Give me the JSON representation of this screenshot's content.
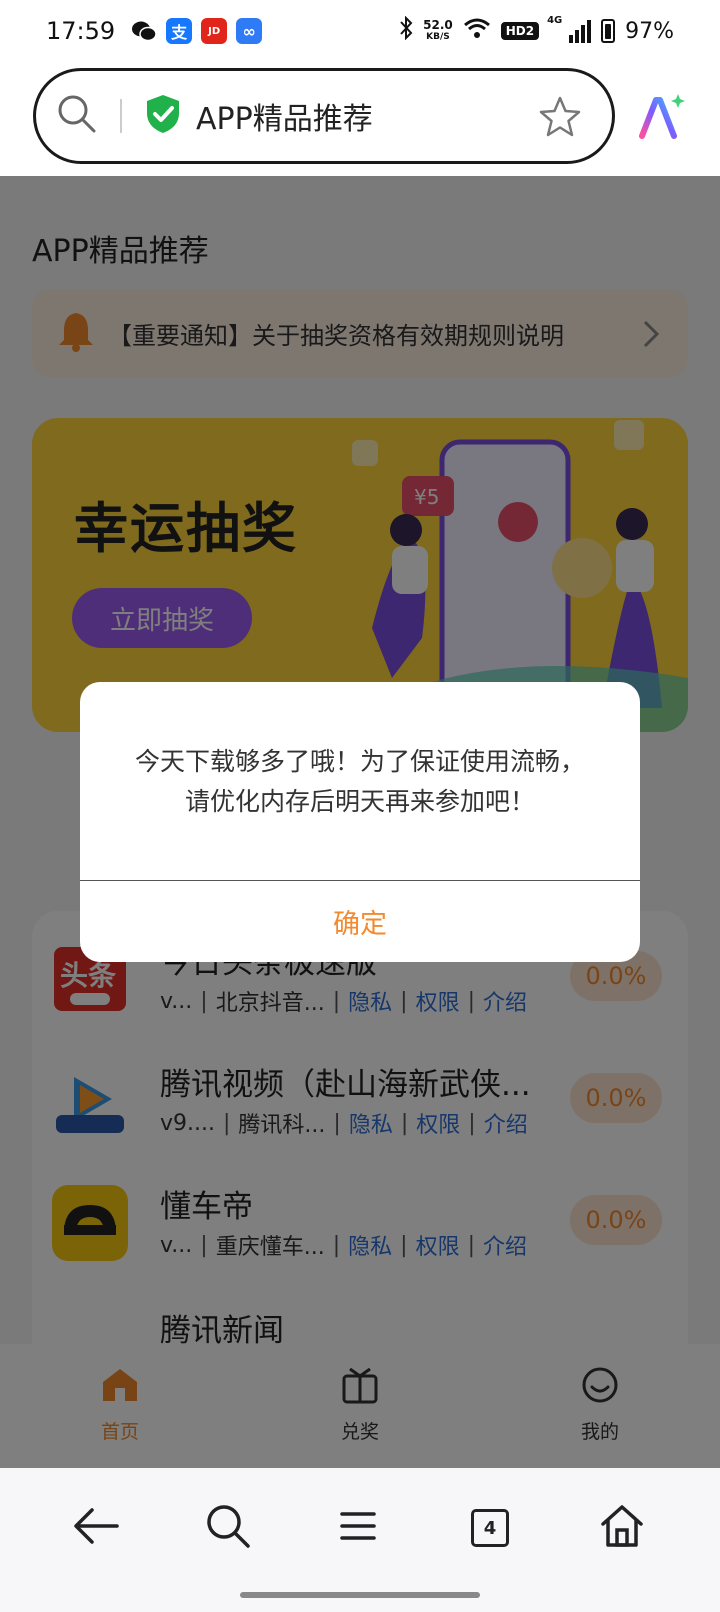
{
  "status_bar": {
    "time": "17:59",
    "net_speed": "52.0",
    "net_unit": "KB/S",
    "hd": "HD2",
    "network": "4G",
    "battery": "97%",
    "app_icons": [
      "wechat-icon",
      "alipay-icon",
      "jd-icon",
      "infinity-app-icon"
    ]
  },
  "browser": {
    "address_text": "APP精品推荐"
  },
  "page": {
    "title": "APP精品推荐",
    "notice": "【重要通知】关于抽奖资格有效期规则说明",
    "banner": {
      "title": "幸运抽奖",
      "button": "立即抽奖"
    },
    "apps": [
      {
        "name": "今日头条极速版",
        "version": "v...",
        "developer": "北京抖音...",
        "privacy": "隐私",
        "permissions": "权限",
        "intro": "介绍",
        "percent": "0.0%"
      },
      {
        "name": "腾讯视频（赴山海新武侠...",
        "version": "v9....",
        "developer": "腾讯科...",
        "privacy": "隐私",
        "permissions": "权限",
        "intro": "介绍",
        "percent": "0.0%"
      },
      {
        "name": "懂车帝",
        "version": "v...",
        "developer": "重庆懂车...",
        "privacy": "隐私",
        "permissions": "权限",
        "intro": "介绍",
        "percent": "0.0%"
      },
      {
        "name": "腾讯新闻"
      }
    ],
    "tabs": [
      {
        "label": "首页",
        "icon": "home-icon",
        "active": true
      },
      {
        "label": "兑奖",
        "icon": "redeem-icon",
        "active": false
      },
      {
        "label": "我的",
        "icon": "profile-icon",
        "active": false
      }
    ]
  },
  "dialog": {
    "message_line1": "今天下载够多了哦！为了保证使用流畅，",
    "message_line2": "请优化内存后明天再来参加吧！",
    "ok": "确定"
  },
  "bottom_nav": {
    "tab_count": "4"
  },
  "colors": {
    "accent": "#f28a2e",
    "link": "#2f6fd6",
    "banner": "#ffd43b",
    "banner_button": "#9c5cf0"
  }
}
